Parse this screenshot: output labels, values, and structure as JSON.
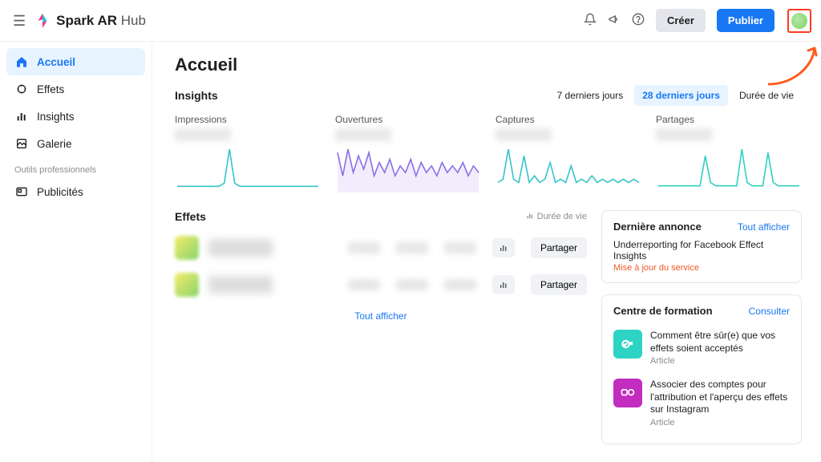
{
  "brand": {
    "name_bold": "Spark AR",
    "name_light": " Hub"
  },
  "topbar": {
    "create_label": "Créer",
    "publish_label": "Publier"
  },
  "sidebar": {
    "items": [
      {
        "label": "Accueil"
      },
      {
        "label": "Effets"
      },
      {
        "label": "Insights"
      },
      {
        "label": "Galerie"
      }
    ],
    "section_label": "Outils professionnels",
    "pro_items": [
      {
        "label": "Publicités"
      }
    ]
  },
  "page": {
    "title": "Accueil"
  },
  "insights": {
    "title": "Insights",
    "ranges": [
      "7 derniers jours",
      "28 derniers jours",
      "Durée de vie"
    ],
    "selected_range_index": 1,
    "metrics": [
      {
        "label": "Impressions"
      },
      {
        "label": "Ouvertures"
      },
      {
        "label": "Captures"
      },
      {
        "label": "Partages"
      }
    ]
  },
  "effects": {
    "title": "Effets",
    "lifetime_label": "Durée de vie",
    "share_label": "Partager",
    "show_all_label": "Tout afficher"
  },
  "announcement": {
    "panel_title": "Dernière annonce",
    "show_all": "Tout afficher",
    "headline": "Underreporting for Facebook Effect Insights",
    "tag": "Mise à jour du service"
  },
  "learning": {
    "panel_title": "Centre de formation",
    "cta": "Consulter",
    "items": [
      {
        "title": "Comment être sûr(e) que vos effets soient acceptés",
        "subtitle": "Article"
      },
      {
        "title": "Associer des comptes pour l'attribution et l'aperçu des effets sur Instagram",
        "subtitle": "Article"
      }
    ]
  },
  "chart_data": [
    {
      "type": "line",
      "title": "Impressions",
      "color": "#36c3c9",
      "fill": false,
      "values": [
        2,
        2,
        2,
        2,
        2,
        2,
        2,
        2,
        2,
        3,
        14,
        3,
        2,
        2,
        2,
        2,
        2,
        2,
        2,
        2,
        2,
        2,
        2,
        2,
        2,
        2,
        2,
        2
      ]
    },
    {
      "type": "area",
      "title": "Ouvertures",
      "color": "#8a6fe8",
      "fill": true,
      "values": [
        12,
        5,
        13,
        6,
        11,
        7,
        12,
        5,
        9,
        6,
        10,
        5,
        8,
        6,
        10,
        5,
        9,
        6,
        8,
        5,
        9,
        6,
        8,
        6,
        9,
        5,
        8,
        6
      ]
    },
    {
      "type": "line",
      "title": "Captures",
      "color": "#36c3c9",
      "fill": false,
      "values": [
        3,
        4,
        13,
        4,
        3,
        11,
        3,
        5,
        3,
        4,
        9,
        3,
        4,
        3,
        8,
        3,
        4,
        3,
        5,
        3,
        4,
        3,
        4,
        3,
        4,
        3,
        4,
        3
      ]
    },
    {
      "type": "line",
      "title": "Partages",
      "color": "#2ed1c0",
      "fill": false,
      "values": [
        2,
        2,
        2,
        2,
        2,
        2,
        2,
        2,
        2,
        11,
        3,
        2,
        2,
        2,
        2,
        2,
        13,
        3,
        2,
        2,
        2,
        12,
        3,
        2,
        2,
        2,
        2,
        2
      ]
    }
  ]
}
